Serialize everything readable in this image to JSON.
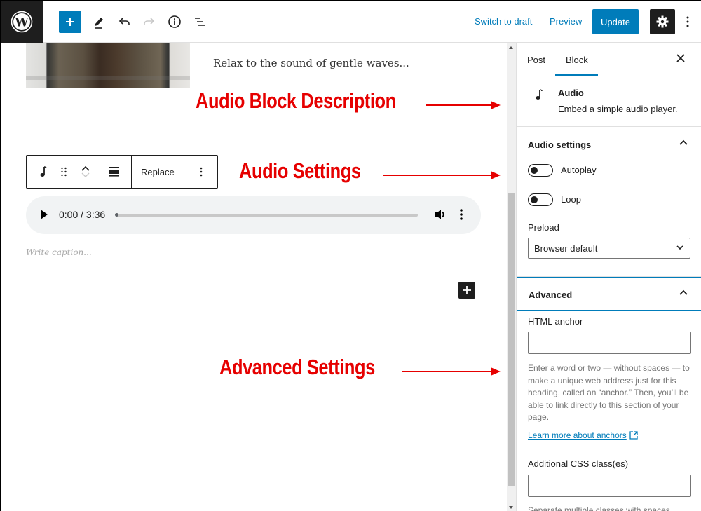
{
  "topbar": {
    "logo": "wordpress-logo",
    "icons": [
      "plus-icon",
      "pencil-icon",
      "undo-icon",
      "redo-icon",
      "info-icon",
      "list-view-icon"
    ],
    "switch_to_draft": "Switch to draft",
    "preview": "Preview",
    "update": "Update",
    "settings_icon": "gear-icon",
    "more_icon": "vertical-ellipsis-icon"
  },
  "editor": {
    "paragraph": "Relax to the sound of gentle waves...",
    "block_toolbar": {
      "replace_label": "Replace"
    },
    "audio_player": {
      "current_time": "0:00",
      "duration": "3:36",
      "time_display": "0:00 / 3:36",
      "progress": 0
    },
    "caption_placeholder": "Write caption..."
  },
  "annotations": {
    "block_description": "Audio Block Description",
    "audio_settings": "Audio Settings",
    "advanced_settings": "Advanced Settings",
    "color": "#e60000"
  },
  "sidebar": {
    "tabs": [
      {
        "label": "Post",
        "active": false
      },
      {
        "label": "Block",
        "active": true
      }
    ],
    "block_card": {
      "title": "Audio",
      "description": "Embed a simple audio player."
    },
    "audio_settings": {
      "title": "Audio settings",
      "autoplay_label": "Autoplay",
      "autoplay_on": false,
      "loop_label": "Loop",
      "loop_on": false,
      "preload_label": "Preload",
      "preload_value": "Browser default"
    },
    "advanced": {
      "title": "Advanced",
      "html_anchor_label": "HTML anchor",
      "html_anchor_value": "",
      "anchor_help": "Enter a word or two — without spaces — to make a unique web address just for this heading, called an “anchor.” Then, you’ll be able to link directly to this section of your page.",
      "learn_more_link": "Learn more about anchors",
      "css_class_label": "Additional CSS class(es)",
      "css_class_value": "",
      "css_class_help": "Separate multiple classes with spaces."
    }
  },
  "colors": {
    "accent": "#007cba",
    "dark": "#1e1e1e"
  }
}
